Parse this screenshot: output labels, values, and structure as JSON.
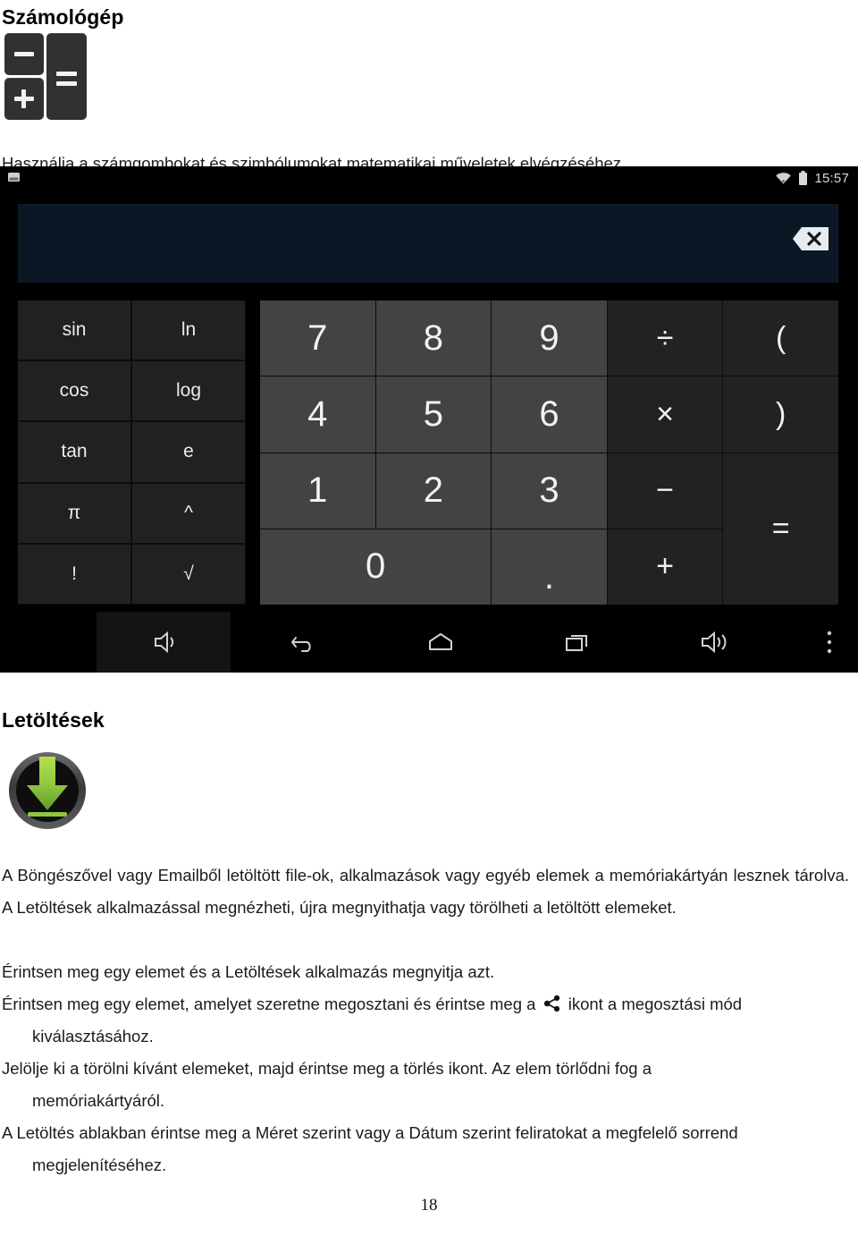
{
  "document": {
    "page_number": "18"
  },
  "sections": {
    "calculator": {
      "title": "Számológép",
      "icon": "calculator-app-icon",
      "intro": "Használja a számgombokat és szimbólumokat matematikai műveletek elvégzéséhez."
    },
    "downloads": {
      "title": "Letöltések",
      "icon": "downloads-app-icon",
      "paragraphs": {
        "p1": "A Böngészővel vagy Emailből letöltött file-ok, alkalmazások vagy egyéb elemek a memóriakártyán lesznek tárolva. A Letöltések alkalmazással megnézheti, újra megnyithatja vagy törölheti a letöltött elemeket.",
        "p2": "Érintsen meg egy elemet és a Letöltések alkalmazás megnyitja azt.",
        "p3_before_icon": "Érintsen meg egy elemet, amelyet szeretne megosztani és érintse meg a",
        "p3_icon": "share-icon",
        "p3_after_icon": "ikont a megosztási mód",
        "p3_line2": "kiválasztásához.",
        "p4_line1": "Jelölje ki a törölni kívánt elemeket, majd érintse meg a törlés ikont. Az elem törlődni fog a",
        "p4_line2": "memóriakártyáról.",
        "p5_line1": "A Letöltés ablakban érintse meg a Méret szerint vagy a Dátum szerint feliratokat a megfelelő sorrend",
        "p5_line2": "megjelenítéséhez."
      }
    }
  },
  "screenshot": {
    "status_bar": {
      "left_icon": "sd-card-icon",
      "wifi_icon": "wifi-icon",
      "battery_icon": "battery-icon",
      "clock": "15:57"
    },
    "display": {
      "value": "",
      "backspace_label": "×"
    },
    "function_keys": [
      {
        "label": "sin",
        "name": "key-sin"
      },
      {
        "label": "ln",
        "name": "key-ln"
      },
      {
        "label": "cos",
        "name": "key-cos"
      },
      {
        "label": "log",
        "name": "key-log"
      },
      {
        "label": "tan",
        "name": "key-tan"
      },
      {
        "label": "e",
        "name": "key-e"
      },
      {
        "label": "π",
        "name": "key-pi"
      },
      {
        "label": "^",
        "name": "key-power"
      },
      {
        "label": "!",
        "name": "key-factorial"
      },
      {
        "label": "√",
        "name": "key-sqrt"
      }
    ],
    "number_keys": {
      "r1": [
        "7",
        "8",
        "9"
      ],
      "r2": [
        "4",
        "5",
        "6"
      ],
      "r3": [
        "1",
        "2",
        "3"
      ],
      "zero": "0",
      "dot": "."
    },
    "operator_keys": {
      "divide": "÷",
      "multiply": "×",
      "minus": "−",
      "plus": "+",
      "paren_open": "(",
      "paren_close": ")",
      "equals": "="
    },
    "nav_bar": {
      "items": [
        {
          "name": "volume-down-icon"
        },
        {
          "name": "back-icon"
        },
        {
          "name": "home-icon"
        },
        {
          "name": "recent-apps-icon"
        },
        {
          "name": "volume-up-icon"
        },
        {
          "name": "overflow-menu-icon"
        }
      ]
    }
  },
  "colors": {
    "screen_background": "#000000",
    "display_background": "#0b1724",
    "number_key": "#434343",
    "operator_key": "#222222",
    "function_key": "#212121",
    "key_text": "#f2f2f2",
    "download_arrow_green": "#8cc63e"
  }
}
